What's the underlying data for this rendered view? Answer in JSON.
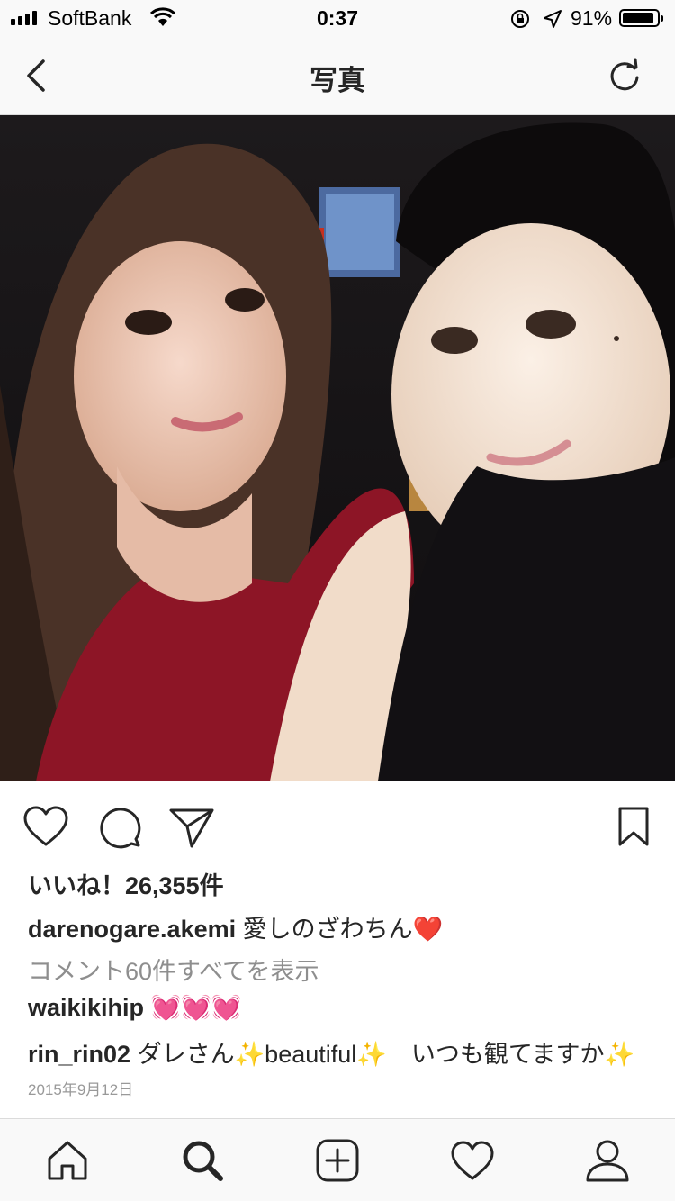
{
  "status_bar": {
    "carrier": "SoftBank",
    "time": "0:37",
    "battery_percent_text": "91%",
    "battery_level": 0.91
  },
  "nav": {
    "title": "写真",
    "back_icon": "chevron-left-icon",
    "refresh_icon": "refresh-icon"
  },
  "post": {
    "image_alt": "selfie-of-two-women",
    "actions": [
      "heart-icon",
      "comment-icon",
      "share-icon",
      "bookmark-icon"
    ],
    "likes": "いいね！26,355件",
    "caption": {
      "user": "darenogare.akemi",
      "text": "愛しのざわちん❤️"
    },
    "view_comments": "コメント60件すべてを表示",
    "comments": [
      {
        "user": "waikikihip",
        "text": " 💓💓💓"
      },
      {
        "user": "rin_rin02",
        "text": " ダレさん✨beautiful✨　いつも観てますか✨"
      }
    ],
    "date": "2015年9月12日"
  },
  "tab_bar": {
    "items": [
      "home-icon",
      "search-icon",
      "add-icon",
      "activity-icon",
      "profile-icon"
    ]
  }
}
